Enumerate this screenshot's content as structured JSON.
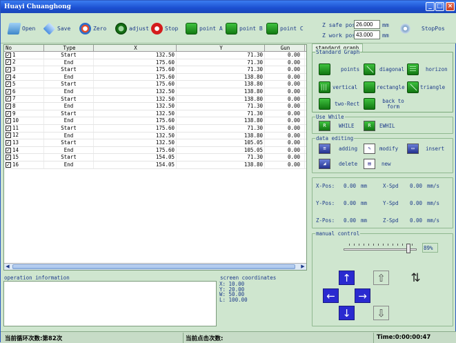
{
  "window": {
    "title": "Huayi Chuanghong"
  },
  "toolbar": {
    "open": "Open",
    "save": "Save",
    "zero": "Zero",
    "adjust": "adjust",
    "stop": "Stop",
    "point_a": "point A",
    "point_b": "point B",
    "point_c": "point C",
    "z_safe_label": "Z safe pos",
    "z_safe_value": "26.000",
    "z_safe_unit": "mm",
    "z_work_label": "Z work pos",
    "z_work_value": "43.000",
    "z_work_unit": "mm",
    "stoppos": "StopPos"
  },
  "table": {
    "headers": [
      "No",
      "Type",
      "X",
      "Y",
      "Gun"
    ],
    "rows": [
      {
        "no": "1",
        "type": "Start",
        "x": "132.50",
        "y": "71.30",
        "gun": "0.00"
      },
      {
        "no": "2",
        "type": "End",
        "x": "175.60",
        "y": "71.30",
        "gun": "0.00"
      },
      {
        "no": "3",
        "type": "Start",
        "x": "175.60",
        "y": "71.30",
        "gun": "0.00"
      },
      {
        "no": "4",
        "type": "End",
        "x": "175.60",
        "y": "138.80",
        "gun": "0.00"
      },
      {
        "no": "5",
        "type": "Start",
        "x": "175.60",
        "y": "138.80",
        "gun": "0.00"
      },
      {
        "no": "6",
        "type": "End",
        "x": "132.50",
        "y": "138.80",
        "gun": "0.00"
      },
      {
        "no": "7",
        "type": "Start",
        "x": "132.50",
        "y": "138.80",
        "gun": "0.00"
      },
      {
        "no": "8",
        "type": "End",
        "x": "132.50",
        "y": "71.30",
        "gun": "0.00"
      },
      {
        "no": "9",
        "type": "Start",
        "x": "132.50",
        "y": "71.30",
        "gun": "0.00"
      },
      {
        "no": "10",
        "type": "End",
        "x": "175.60",
        "y": "138.80",
        "gun": "0.00"
      },
      {
        "no": "11",
        "type": "Start",
        "x": "175.60",
        "y": "71.30",
        "gun": "0.00"
      },
      {
        "no": "12",
        "type": "End",
        "x": "132.50",
        "y": "138.80",
        "gun": "0.00"
      },
      {
        "no": "13",
        "type": "Start",
        "x": "132.50",
        "y": "105.05",
        "gun": "0.00"
      },
      {
        "no": "14",
        "type": "End",
        "x": "175.60",
        "y": "105.05",
        "gun": "0.00"
      },
      {
        "no": "15",
        "type": "Start",
        "x": "154.05",
        "y": "71.30",
        "gun": "0.00"
      },
      {
        "no": "16",
        "type": "End",
        "x": "154.05",
        "y": "138.80",
        "gun": "0.00"
      }
    ]
  },
  "right": {
    "tab": "standard graph",
    "standard_graph": "Standard Graph",
    "points": "points",
    "diagonal": "diagonal",
    "horizon": "horizon",
    "vertical": "vertical",
    "rectangle": "rectangle",
    "triangle": "triangle",
    "two_rect": "two-Rect",
    "back_to_form": "back to form",
    "use_while": "Use While",
    "while": "WHILE",
    "ewhil": "EWHIL",
    "data_editing": "data editing",
    "adding": "adding",
    "modify": "modify",
    "insert": "insert",
    "delete": "delete",
    "new": "new"
  },
  "readouts": {
    "xpos_label": "X-Pos:",
    "xpos": "0.00",
    "xpos_unit": "mm",
    "xspd_label": "X-Spd",
    "xspd": "0.00",
    "xspd_unit": "mm/s",
    "ypos_label": "Y-Pos:",
    "ypos": "0.00",
    "ypos_unit": "mm",
    "yspd_label": "Y-Spd",
    "yspd": "0.00",
    "yspd_unit": "mm/s",
    "zpos_label": "Z-Pos:",
    "zpos": "0.00",
    "zpos_unit": "mm",
    "zspd_label": "Z-Spd",
    "zspd": "0.00",
    "zspd_unit": "mm/s"
  },
  "manual": {
    "label": "manual control",
    "speed": "89%",
    "speed_value": 0.89
  },
  "operation": {
    "label": "operation information"
  },
  "screen": {
    "label": "screen coordinates",
    "x": "X:   10.00",
    "y": "Y:   20.00",
    "w": "W:   50.00",
    "l": "L:  100.00"
  },
  "status": {
    "cycles": "当前循环次数:第82次",
    "clicks": "当前点击次数:",
    "time": "Time:0:00:00:47"
  }
}
